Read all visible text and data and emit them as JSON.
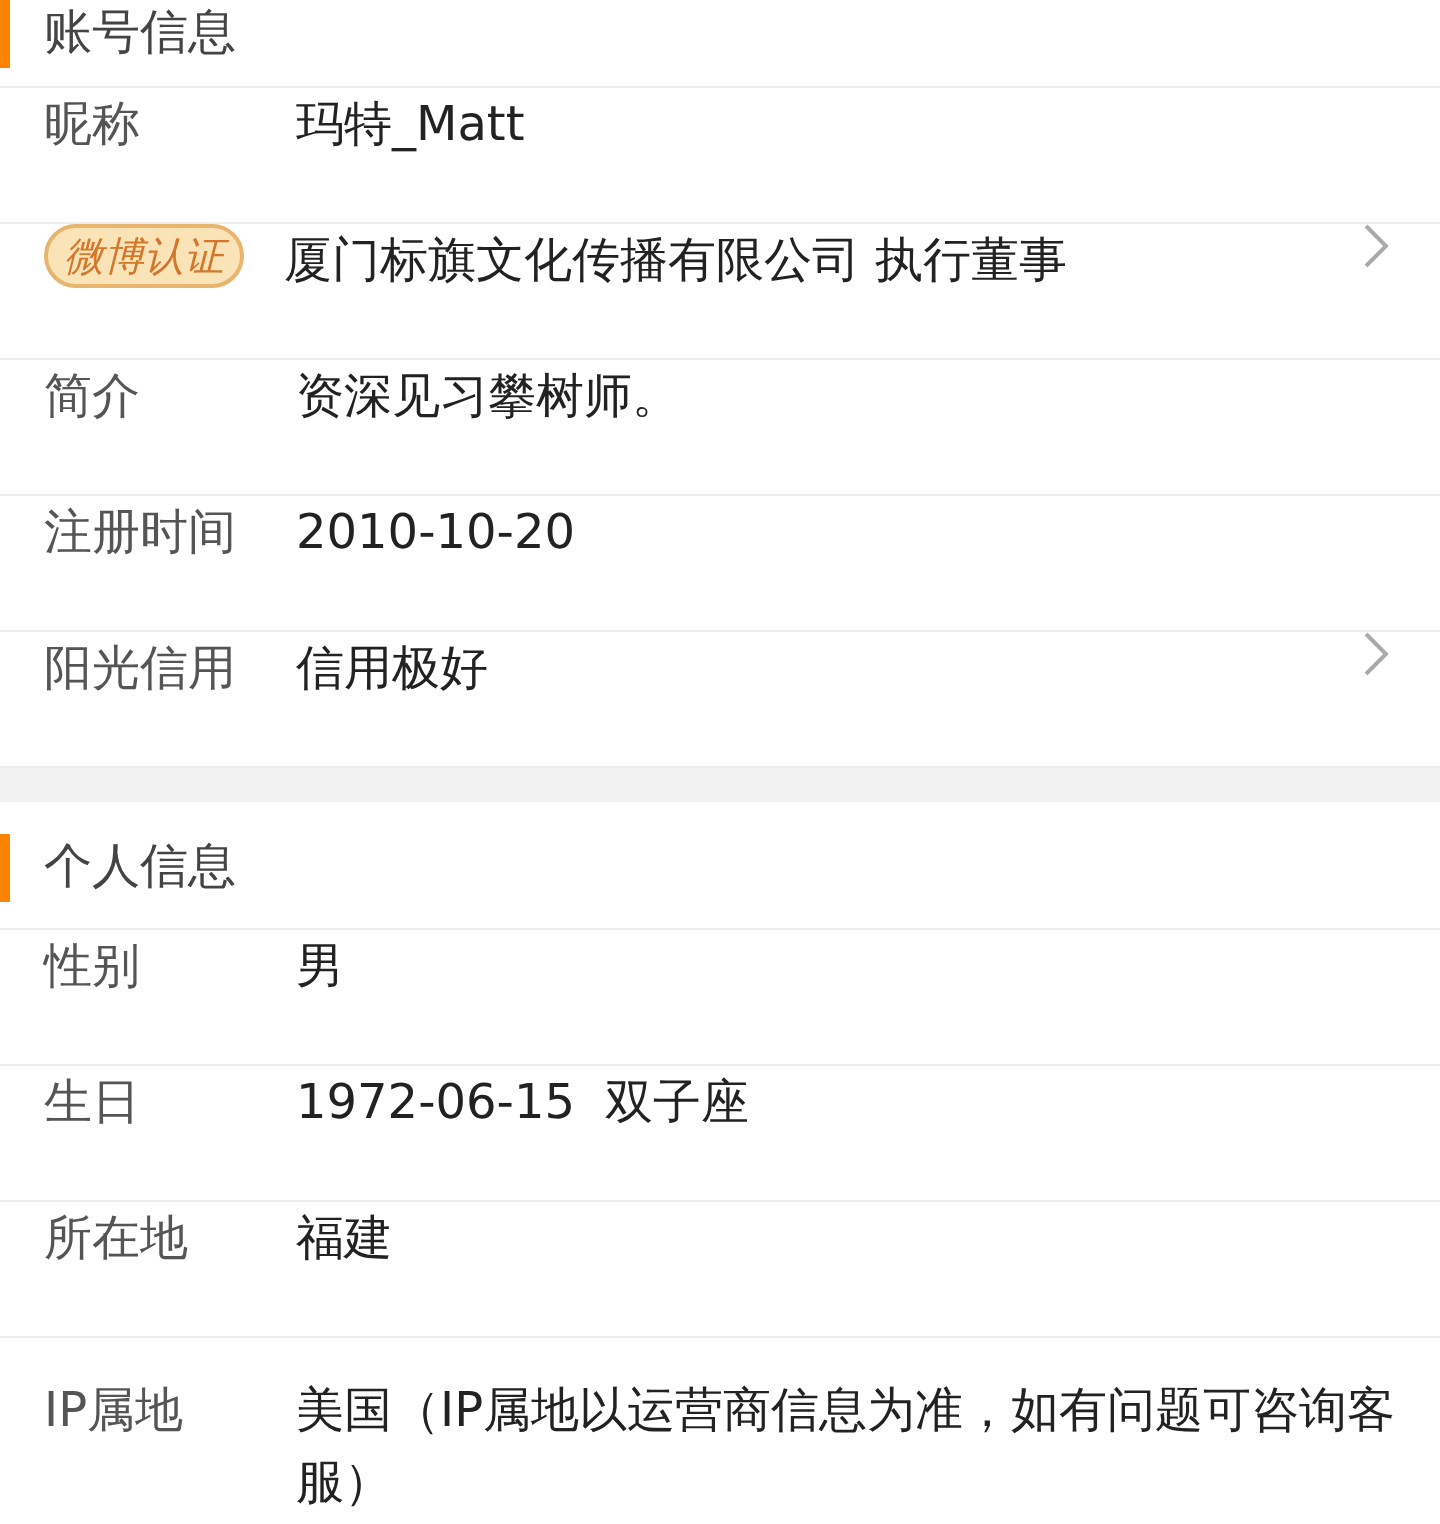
{
  "sections": [
    {
      "title": "账号信息",
      "rows": [
        {
          "kind": "text",
          "label": "昵称",
          "value": "玛特_Matt",
          "has_arrow": false
        },
        {
          "kind": "badge",
          "label": "微博认证",
          "value": "厦门标旗文化传播有限公司 执行董事",
          "has_arrow": true
        },
        {
          "kind": "text",
          "label": "简介",
          "value": "资深见习攀树师。",
          "has_arrow": false
        },
        {
          "kind": "text",
          "label": "注册时间",
          "value": "2010-10-20",
          "has_arrow": false
        },
        {
          "kind": "text",
          "label": "阳光信用",
          "value": "信用极好",
          "has_arrow": true
        }
      ]
    },
    {
      "title": "个人信息",
      "rows": [
        {
          "kind": "text",
          "label": "性别",
          "value": "男",
          "has_arrow": false
        },
        {
          "kind": "text",
          "label": "生日",
          "value": "1972-06-15  双子座",
          "has_arrow": false
        },
        {
          "kind": "text",
          "label": "所在地",
          "value": "福建",
          "has_arrow": false
        },
        {
          "kind": "text",
          "label": "IP属地",
          "value": "美国（IP属地以运营商信息为准，如有问题可咨询客服）",
          "has_arrow": false
        }
      ]
    }
  ]
}
